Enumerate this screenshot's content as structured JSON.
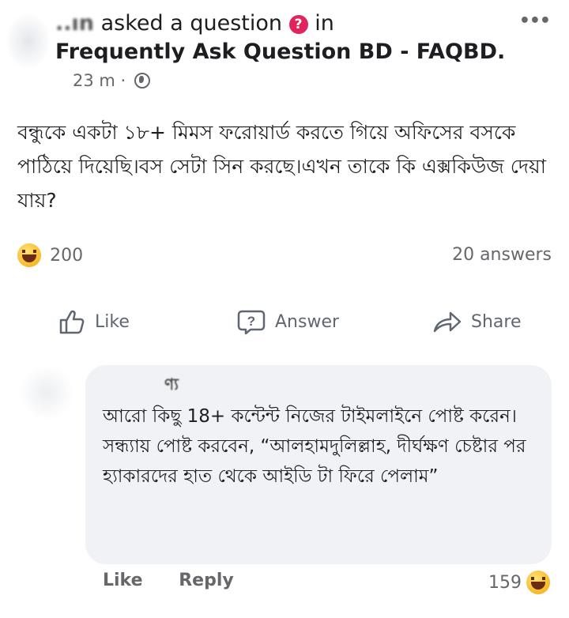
{
  "post": {
    "author_name": "..ın",
    "author_action": "asked a question",
    "in_label": "in",
    "group_name": "Frequently Ask Question BD - FAQBD.",
    "time": "23 m",
    "more_label": "•••"
  },
  "question": {
    "text": "বন্ধুকে একটা ১৮+ মিমস ফরোয়ার্ড করতে গিয়ে অফিসের বসকে পাঠিয়ে দিয়েছি।বস সেটা সিন করছে।এখন তাকে কি এক্সকিউজ দেয়া যায়?"
  },
  "stats": {
    "reaction_count": "200",
    "answers_count": "20 answers"
  },
  "actions": {
    "like": "Like",
    "answer": "Answer",
    "share": "Share"
  },
  "comment": {
    "author": "ণ্য",
    "text": "আরো কিছু 18+ কন্টেন্ট নিজের টাইমলাইনে পোষ্ট করেন।\nসন্ধ্যায় পোষ্ট করবেন, “আলহামদুলিল্লাহ, দীর্ঘক্ষণ চেষ্টার পর হ্যাকারদের হাত থেকে আইডি টা ফিরে পেলাম”",
    "like_label": "Like",
    "reply_label": "Reply",
    "reaction_count": "159"
  },
  "colors": {
    "accent_question": "#e0245e",
    "text_secondary": "#65676b",
    "bubble_bg": "#f0f2f5"
  }
}
